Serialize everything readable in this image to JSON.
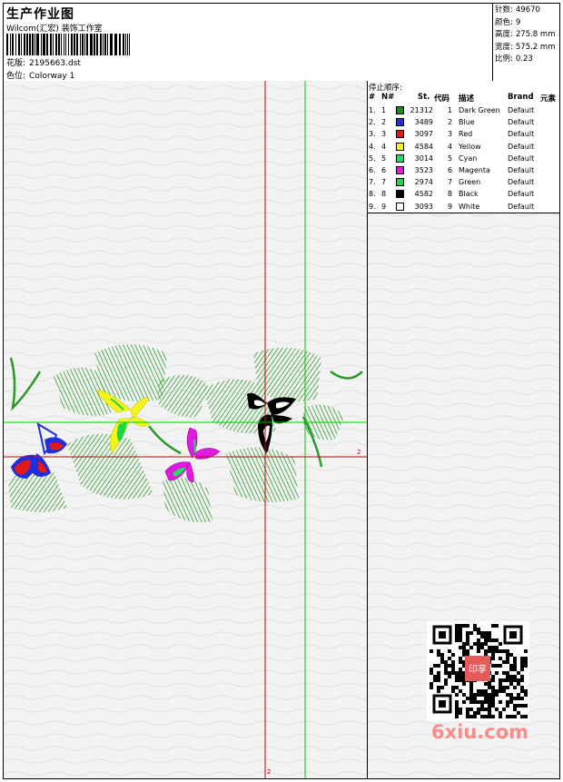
{
  "header": {
    "title": "生产作业图",
    "company": "Wilcom(汇宏) 装饰工作室",
    "file_label": "花版:",
    "file_value": "2195663.dst",
    "colorway_label": "色位:",
    "colorway_value": "Colorway 1"
  },
  "stats": {
    "stitches_label": "针数:",
    "stitches_value": "49670",
    "colors_label": "颜色:",
    "colors_value": "9",
    "height_label": "高度:",
    "height_value": "275.8 mm",
    "width_label": "宽度:",
    "width_value": "575.2 mm",
    "scale_label": "比例:",
    "scale_value": "0.23"
  },
  "stop_sequence": {
    "title": "停止顺序:",
    "headers": [
      "#",
      "N#",
      "St.",
      "代码",
      "描述",
      "Brand",
      "元素"
    ],
    "rows": [
      {
        "num": "1.",
        "n": "1",
        "color": "#1a8c1a",
        "st": "21312",
        "code": "1",
        "desc": "Dark Green",
        "brand": "Default"
      },
      {
        "num": "2.",
        "n": "2",
        "color": "#1f2fe0",
        "st": "3489",
        "code": "2",
        "desc": "Blue",
        "brand": "Default"
      },
      {
        "num": "3.",
        "n": "3",
        "color": "#e01a1a",
        "st": "3097",
        "code": "3",
        "desc": "Red",
        "brand": "Default"
      },
      {
        "num": "4.",
        "n": "4",
        "color": "#f5f51a",
        "st": "4584",
        "code": "4",
        "desc": "Yellow",
        "brand": "Default"
      },
      {
        "num": "5.",
        "n": "5",
        "color": "#1ae05a",
        "st": "3014",
        "code": "5",
        "desc": "Cyan",
        "brand": "Default"
      },
      {
        "num": "6.",
        "n": "6",
        "color": "#e01ae0",
        "st": "3523",
        "code": "6",
        "desc": "Magenta",
        "brand": "Default"
      },
      {
        "num": "7.",
        "n": "7",
        "color": "#1ad84a",
        "st": "2974",
        "code": "7",
        "desc": "Green",
        "brand": "Default"
      },
      {
        "num": "8.",
        "n": "8",
        "color": "#000000",
        "st": "4582",
        "code": "8",
        "desc": "Black",
        "brand": "Default"
      },
      {
        "num": "9.",
        "n": "9",
        "color": "#ffffff",
        "st": "3093",
        "code": "9",
        "desc": "White",
        "brand": "Default"
      }
    ]
  },
  "canvas": {
    "axis_x_label": "2",
    "axis_y_label": "2"
  },
  "watermark": {
    "stamp_text": "印享",
    "logo_text": "6xiu.com"
  },
  "colors": {
    "leaf_green": "#2a9b2a",
    "axis_red": "#d00000",
    "guide_green": "#00c800"
  }
}
